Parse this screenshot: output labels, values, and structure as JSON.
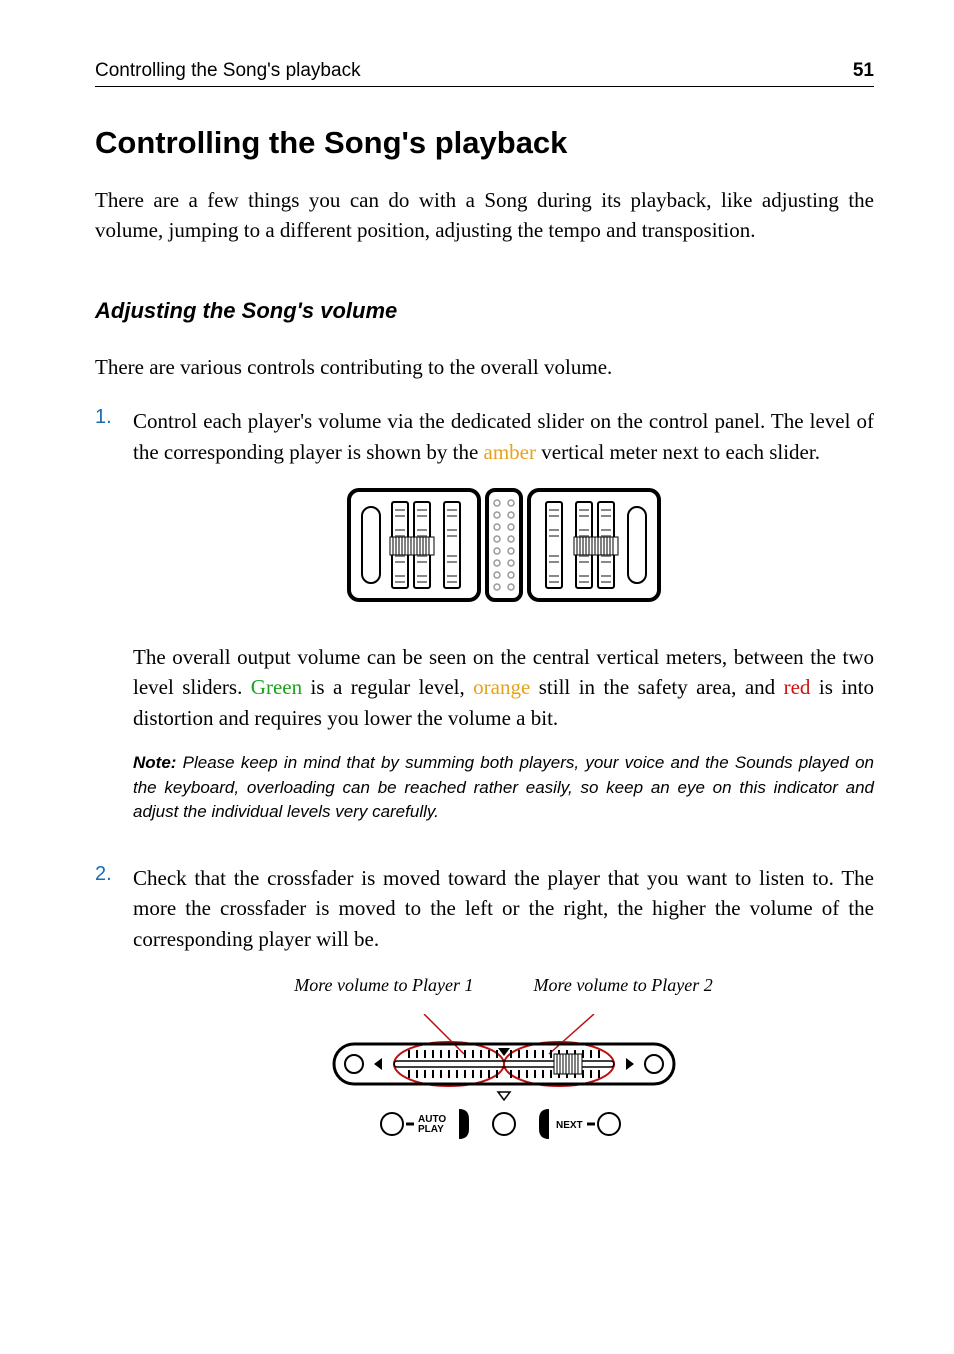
{
  "header": {
    "title": "Controlling the Song's playback",
    "pageNumber": "51"
  },
  "h1": "Controlling the Song's playback",
  "intro": "There are a few things you can do with a Song during its playback, like adjusting the volume, jumping to a different position, adjusting the tempo and transposition.",
  "h2": "Adjusting the Song's volume",
  "subintro": "There are various controls contributing to the overall volume.",
  "steps": [
    {
      "num": "1.",
      "p1_a": "Control each player's volume via the dedicated slider on the control panel. The level of the corresponding player is shown by the ",
      "p1_amber": "amber",
      "p1_b": " vertical meter next to each slider.",
      "p2_a": "The overall output volume can be seen on the central vertical meters, between the two level sliders. ",
      "p2_green": "Green",
      "p2_b": " is a regular level, ",
      "p2_orange": "orange",
      "p2_c": " still in the safety area, and ",
      "p2_red": "red",
      "p2_d": " is into distortion and requires you lower the volume a bit.",
      "note_label": "Note:",
      "note": " Please keep in mind that by summing both players, your voice and the Sounds played on the keyboard, overloading can be reached rather easily, so keep an eye on this indicator and adjust the individual levels very carefully."
    },
    {
      "num": "2.",
      "p1": "Check that the crossfader is moved toward the player that you want to listen to. The more the crossfader is moved to the left or the right, the higher the volume of the corresponding player will be."
    }
  ],
  "crossfader": {
    "left_label": "More volume to Player 1",
    "right_label": "More volume to Player 2",
    "auto_play": "AUTO PLAY",
    "next": "NEXT"
  }
}
